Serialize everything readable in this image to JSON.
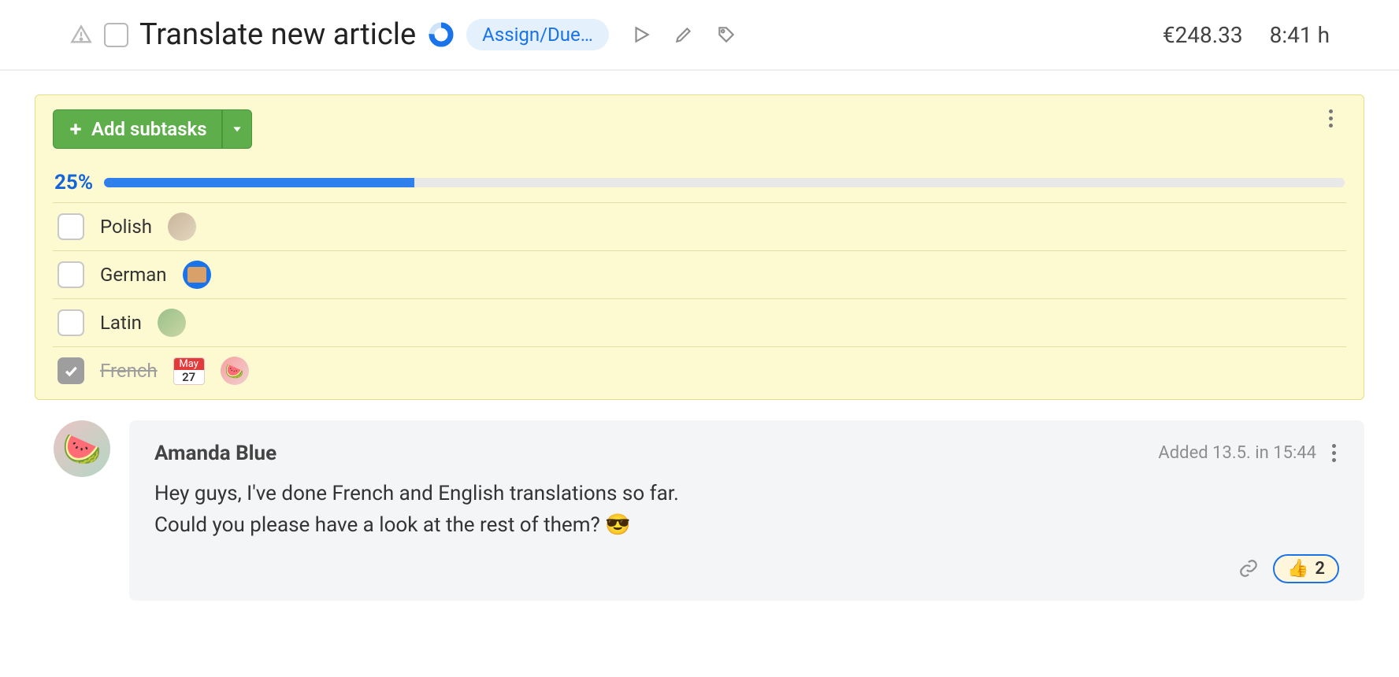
{
  "header": {
    "title": "Translate new article",
    "assign_pill": "Assign/Due…",
    "cost": "€248.33",
    "time": "8:41 h"
  },
  "subpanel": {
    "add_label": "Add subtasks",
    "progress_pct": "25%",
    "progress_fill": 25,
    "subtasks": [
      {
        "label": "Polish",
        "done": false,
        "due": null,
        "avatar": "av1"
      },
      {
        "label": "German",
        "done": false,
        "due": null,
        "avatar": "av2"
      },
      {
        "label": "Latin",
        "done": false,
        "due": null,
        "avatar": "av3"
      },
      {
        "label": "French",
        "done": true,
        "due": {
          "month": "May",
          "day": "27"
        },
        "avatar": "av4"
      }
    ]
  },
  "comment": {
    "author": "Amanda Blue",
    "meta": "Added 13.5. in 15:44",
    "line1": "Hey guys, I've done French and English translations so far.",
    "line2": "Could you please have a look at the rest of them? 😎",
    "reactions_count": "2"
  }
}
